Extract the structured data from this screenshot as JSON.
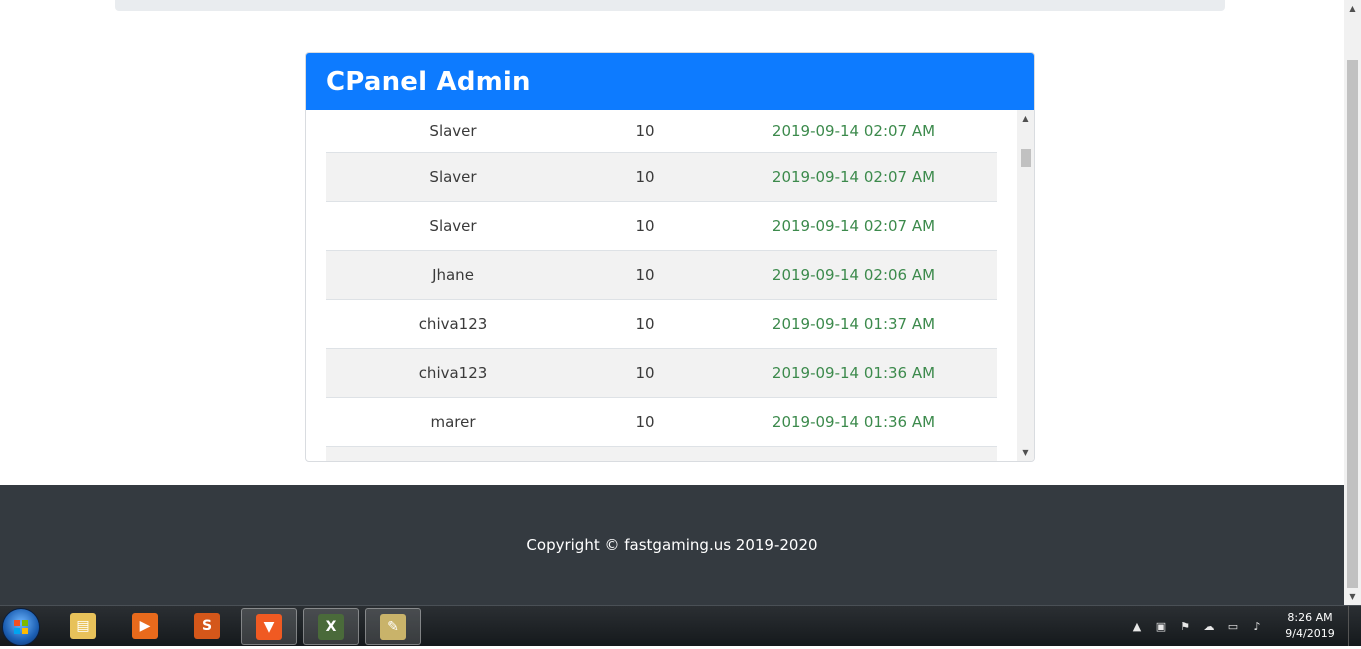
{
  "card": {
    "title": "CPanel Admin"
  },
  "rows": [
    {
      "name": "Slaver",
      "num": "10",
      "date": "2019-09-14 02:07 AM"
    },
    {
      "name": "Slaver",
      "num": "10",
      "date": "2019-09-14 02:07 AM"
    },
    {
      "name": "Slaver",
      "num": "10",
      "date": "2019-09-14 02:07 AM"
    },
    {
      "name": "Jhane",
      "num": "10",
      "date": "2019-09-14 02:06 AM"
    },
    {
      "name": "chiva123",
      "num": "10",
      "date": "2019-09-14 01:37 AM"
    },
    {
      "name": "chiva123",
      "num": "10",
      "date": "2019-09-14 01:36 AM"
    },
    {
      "name": "marer",
      "num": "10",
      "date": "2019-09-14 01:36 AM"
    }
  ],
  "footer": {
    "text": "Copyright © fastgaming.us 2019-2020"
  },
  "taskbar": {
    "apps": [
      {
        "icon": "file-explorer-icon"
      },
      {
        "icon": "media-player-icon"
      },
      {
        "icon": "sublime-text-icon"
      },
      {
        "icon": "brave-browser-icon",
        "active": true
      },
      {
        "icon": "xampp-icon",
        "active": true
      },
      {
        "icon": "paint-icon",
        "active": true
      }
    ],
    "clock": {
      "time": "8:26 AM",
      "date": "9/4/2019"
    }
  },
  "colors": {
    "header": "#0d7bff",
    "date_text": "#3c8a4c",
    "footer_bg": "#343a40"
  }
}
